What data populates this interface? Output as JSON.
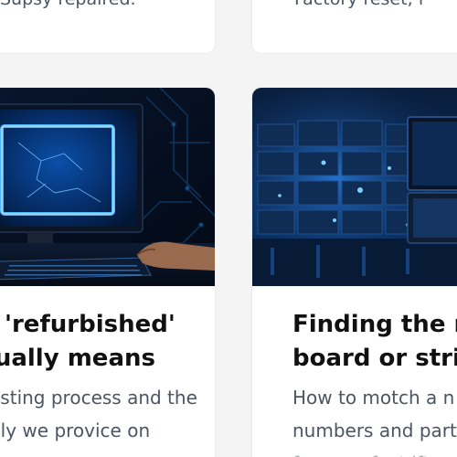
{
  "top_cards": {
    "left_text": "Supsy repaired.",
    "right_text": "Factory reset, f"
  },
  "cards": [
    {
      "title_line1": "at  'refurbished'",
      "title_line2": "ctually means",
      "desc_line1": "esting process and the",
      "desc_line2": "nly we provice on",
      "image_icon": "computer-monitor-image"
    },
    {
      "title_line1": "Finding the rig",
      "title_line2": "board or strip",
      "desc_line1": "How to motch a n",
      "desc_line2": "numbers and part",
      "desc_line3": "for a perfect ift",
      "image_icon": "server-room-image"
    }
  ],
  "colors": {
    "page_bg": "#f4f4f5",
    "card_bg": "#ffffff",
    "title": "#111111",
    "body_text": "#4b5563",
    "accent_blue": "#1e90ff"
  }
}
